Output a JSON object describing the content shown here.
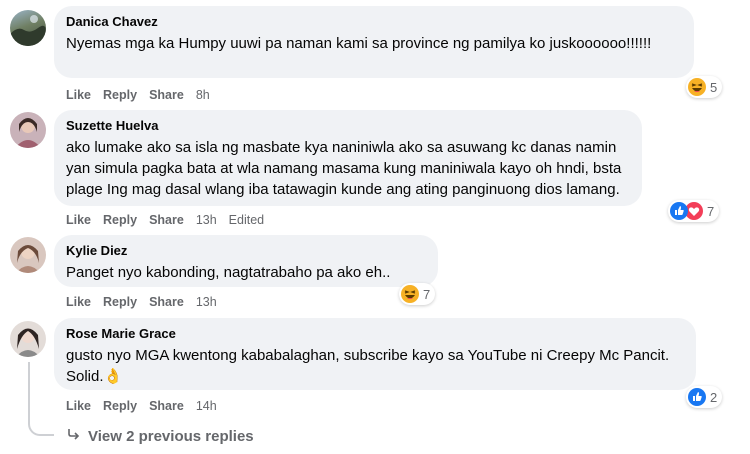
{
  "comments": [
    {
      "author": "Danica Chavez",
      "text": "Nyemas mga ka Humpy uuwi pa naman kami sa province ng pamilya ko juskoooooo!!!!!!",
      "actions": {
        "like": "Like",
        "reply": "Reply",
        "share": "Share"
      },
      "time": "8h",
      "edited": "",
      "reactions": {
        "icons": [
          "haha-emoji"
        ],
        "count": "5"
      }
    },
    {
      "author": "Suzette Huelva",
      "text": "ako lumake ako sa isla ng masbate kya naniniwla ako sa asuwang kc danas namin yan simula pagka bata at wla namang masama kung maniniwala kayo oh hndi, bsta plage Ing mag dasal wlang iba tatawagin kunde ang ating panginuong dios lamang.",
      "actions": {
        "like": "Like",
        "reply": "Reply",
        "share": "Share"
      },
      "time": "13h",
      "edited": "Edited",
      "reactions": {
        "icons": [
          "like-emoji",
          "love-emoji"
        ],
        "count": "7"
      }
    },
    {
      "author": "Kylie Diez",
      "text": "Panget nyo kabonding, nagtatrabaho pa ako eh..",
      "actions": {
        "like": "Like",
        "reply": "Reply",
        "share": "Share"
      },
      "time": "13h",
      "edited": "",
      "reactions": {
        "icons": [
          "haha-emoji"
        ],
        "count": "7"
      }
    },
    {
      "author": "Rose Marie Grace",
      "text": "gusto nyo MGA kwentong kababalaghan, subscribe kayo sa YouTube ni Creepy Mc Pancit. Solid.👌",
      "actions": {
        "like": "Like",
        "reply": "Reply",
        "share": "Share"
      },
      "time": "14h",
      "edited": "",
      "reactions": {
        "icons": [
          "like-emoji"
        ],
        "count": "2"
      }
    }
  ],
  "view_replies": {
    "label": "View 2 previous replies",
    "icon": "reply-arrow-icon"
  },
  "colors": {
    "bubble": "#f0f2f5",
    "meta": "#65676b",
    "like_blue": "#1877f2",
    "love_red": "#f33e58",
    "haha_yellow": "#f7b125"
  }
}
